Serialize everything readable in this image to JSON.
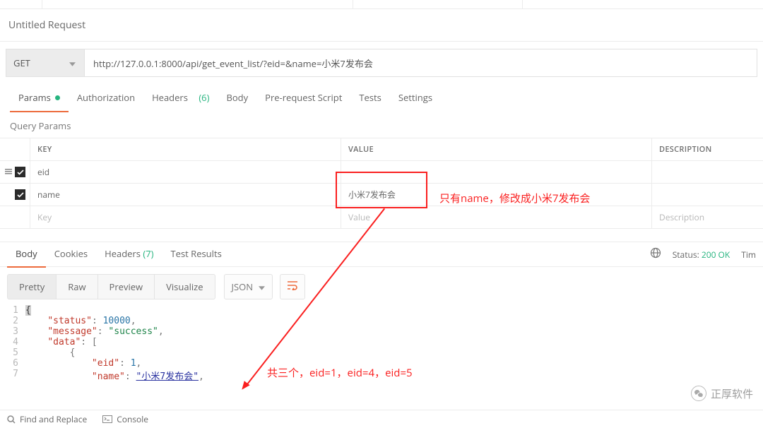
{
  "title": "Untitled Request",
  "method": "GET",
  "url": "http://127.0.0.1:8000/api/get_event_list/?eid=&name=小米7发布会",
  "req_tabs": {
    "params": "Params",
    "auth": "Authorization",
    "headers": "Headers",
    "headers_count": "(6)",
    "body": "Body",
    "prereq": "Pre-request Script",
    "tests": "Tests",
    "settings": "Settings"
  },
  "query": {
    "section": "Query Params",
    "head_key": "KEY",
    "head_value": "VALUE",
    "head_desc": "DESCRIPTION",
    "rows": [
      {
        "key": "eid",
        "value": ""
      },
      {
        "key": "name",
        "value": "小米7发布会"
      }
    ],
    "ph_key": "Key",
    "ph_value": "Value",
    "ph_desc": "Description"
  },
  "annotations": {
    "box_text": "只有name，修改成小米7发布会",
    "note2": "共三个，eid=1，eid=4，eid=5"
  },
  "response": {
    "tabs": {
      "body": "Body",
      "cookies": "Cookies",
      "headers": "Headers",
      "headers_count": "(7)",
      "tests": "Test Results"
    },
    "status_label": "Status:",
    "status_value": "200 OK",
    "time_label": "Tim",
    "viewer": {
      "pretty": "Pretty",
      "raw": "Raw",
      "preview": "Preview",
      "visualize": "Visualize",
      "json": "JSON"
    }
  },
  "chart_data": {
    "type": "table",
    "json_body": {
      "status": 10000,
      "message": "success",
      "data": [
        {
          "eid": 1,
          "name": "小米7发布会"
        }
      ]
    },
    "lines": [
      {
        "n": 1,
        "indent": 0,
        "tokens": [
          {
            "t": "{",
            "c": "brace-hl"
          }
        ]
      },
      {
        "n": 2,
        "indent": 1,
        "tokens": [
          {
            "t": "\"status\"",
            "c": "key"
          },
          {
            "t": ": ",
            "c": "punc"
          },
          {
            "t": "10000",
            "c": "num"
          },
          {
            "t": ",",
            "c": "punc"
          }
        ]
      },
      {
        "n": 3,
        "indent": 1,
        "tokens": [
          {
            "t": "\"message\"",
            "c": "key"
          },
          {
            "t": ": ",
            "c": "punc"
          },
          {
            "t": "\"success\"",
            "c": "str"
          },
          {
            "t": ",",
            "c": "punc"
          }
        ]
      },
      {
        "n": 4,
        "indent": 1,
        "tokens": [
          {
            "t": "\"data\"",
            "c": "key"
          },
          {
            "t": ": [",
            "c": "punc"
          }
        ]
      },
      {
        "n": 5,
        "indent": 2,
        "tokens": [
          {
            "t": "{",
            "c": "punc"
          }
        ]
      },
      {
        "n": 6,
        "indent": 3,
        "tokens": [
          {
            "t": "\"eid\"",
            "c": "key"
          },
          {
            "t": ": ",
            "c": "punc"
          },
          {
            "t": "1",
            "c": "num"
          },
          {
            "t": ",",
            "c": "punc"
          }
        ]
      },
      {
        "n": 7,
        "indent": 3,
        "tokens": [
          {
            "t": "\"name\"",
            "c": "key"
          },
          {
            "t": ": ",
            "c": "punc"
          },
          {
            "t": "\"小米7发布会\"",
            "c": "strname"
          },
          {
            "t": ",",
            "c": "punc"
          }
        ]
      }
    ]
  },
  "footer": {
    "find": "Find and Replace",
    "console": "Console"
  },
  "watermark": "正厚软件"
}
